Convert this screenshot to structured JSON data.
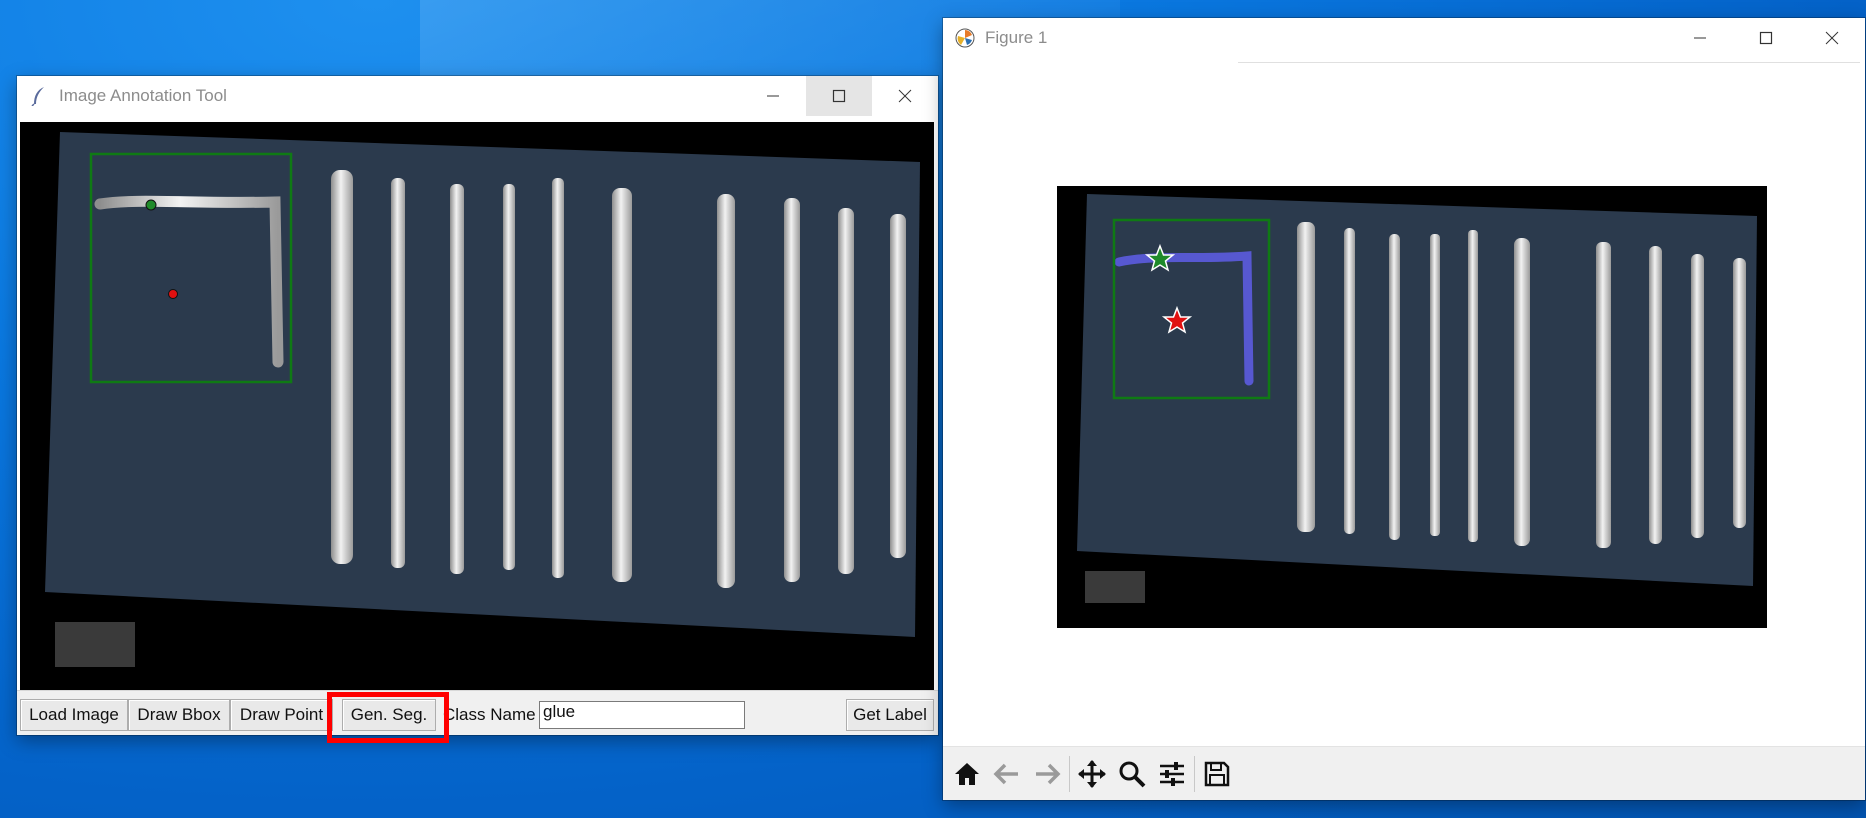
{
  "annotation_window": {
    "title": "Image Annotation Tool",
    "toolbar": {
      "load_image_label": "Load Image",
      "draw_bbox_label": "Draw Bbox",
      "draw_point_label": "Draw Point",
      "gen_seg_label": "Gen. Seg.",
      "class_name_label": "Class Name",
      "class_name_value": "glue",
      "get_label_label": "Get Label"
    }
  },
  "figure_window": {
    "title": "Figure 1",
    "toolbar_icons": [
      "home-icon",
      "back-arrow-icon",
      "forward-arrow-icon",
      "pan-icon",
      "zoom-icon",
      "configure-subplots-icon",
      "save-icon"
    ]
  },
  "colors": {
    "bbox": "#0f7a14",
    "positive_point": "#1f8a2a",
    "negative_point": "#e01010",
    "mask": "#5a5ad8",
    "highlight": "#ff0000",
    "board": "#2b3a4d"
  }
}
